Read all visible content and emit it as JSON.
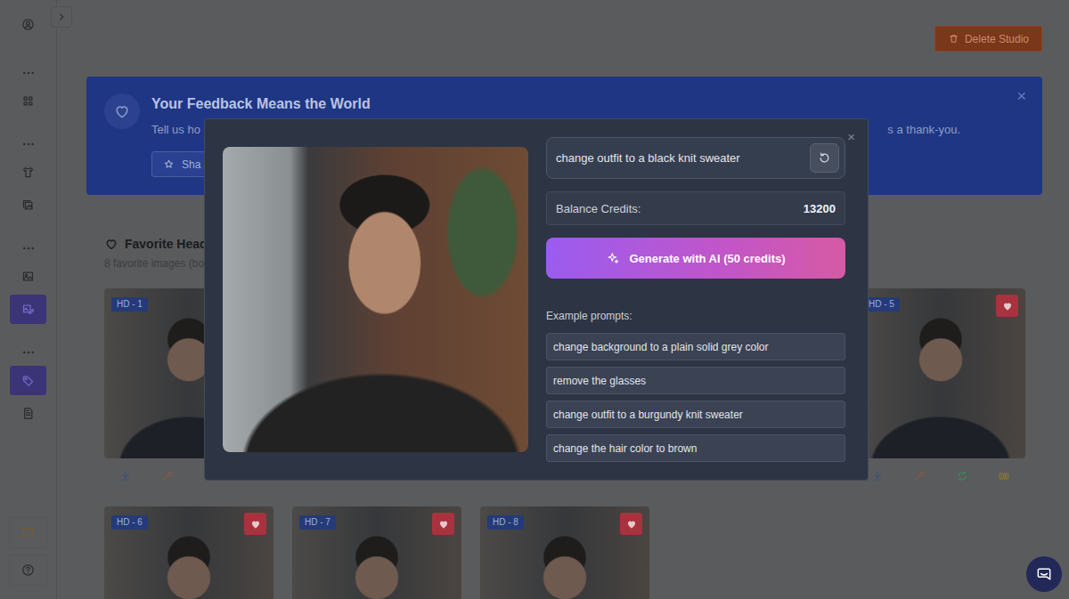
{
  "sidebar": {
    "items": [
      {
        "kind": "icon",
        "selected": false
      },
      {
        "kind": "more",
        "selected": false
      },
      {
        "kind": "icon",
        "selected": false
      },
      {
        "kind": "more",
        "selected": false
      },
      {
        "kind": "icon",
        "selected": false
      },
      {
        "kind": "icon",
        "selected": false
      },
      {
        "kind": "more",
        "selected": false
      },
      {
        "kind": "icon",
        "selected": false
      },
      {
        "kind": "icon",
        "selected": true
      },
      {
        "kind": "more",
        "selected": false
      },
      {
        "kind": "icon",
        "selected": true
      },
      {
        "kind": "icon",
        "selected": false
      }
    ],
    "footer": [
      {
        "selected": false
      },
      {
        "selected": false
      }
    ]
  },
  "header": {
    "delete_button": "Delete Studio"
  },
  "banner": {
    "title": "Your Feedback Means the World",
    "text_start": "Tell us ho",
    "text_end": "s a thank-you.",
    "button": "Sha",
    "close": "×"
  },
  "favorites": {
    "title": "Favorite Heads",
    "subtitle": "8 favorite images (bo",
    "rows": [
      [
        {
          "label": "HD - 1",
          "favorite": true
        },
        {
          "label": "HD - 5",
          "favorite": true
        }
      ],
      [
        {
          "label": "HD - 6",
          "favorite": true
        },
        {
          "label": "HD - 7",
          "favorite": true
        },
        {
          "label": "HD - 8",
          "favorite": true
        }
      ]
    ]
  },
  "modal": {
    "close": "×",
    "prompt": "change outfit to a black knit sweater",
    "balance_label": "Balance Credits:",
    "balance": "13200",
    "generate": "Generate with AI (50 credits)",
    "examples_label": "Example prompts:",
    "examples": [
      "change background to a plain solid grey color",
      "remove the glasses",
      "change outfit to a burgundy knit sweater",
      "change the hair color to brown"
    ]
  }
}
